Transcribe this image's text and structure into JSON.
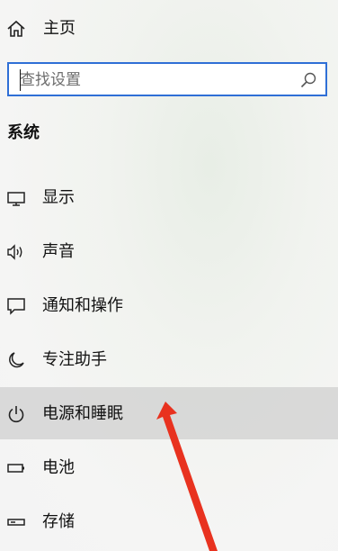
{
  "home": {
    "label": "主页",
    "icon": "home-icon"
  },
  "search": {
    "placeholder": "查找设置",
    "value": "",
    "icon": "search-icon"
  },
  "section_title": "系统",
  "nav_items": [
    {
      "label": "显示",
      "icon": "display-icon"
    },
    {
      "label": "声音",
      "icon": "sound-icon"
    },
    {
      "label": "通知和操作",
      "icon": "notifications-icon"
    },
    {
      "label": "专注助手",
      "icon": "focus-assist-icon"
    },
    {
      "label": "电源和睡眠",
      "icon": "power-icon",
      "selected": true
    },
    {
      "label": "电池",
      "icon": "battery-icon"
    },
    {
      "label": "存储",
      "icon": "storage-icon"
    }
  ],
  "colors": {
    "accent": "#2f6fd6",
    "selected_background": "#d3d3d1",
    "annotation_arrow": "#e8321f"
  }
}
